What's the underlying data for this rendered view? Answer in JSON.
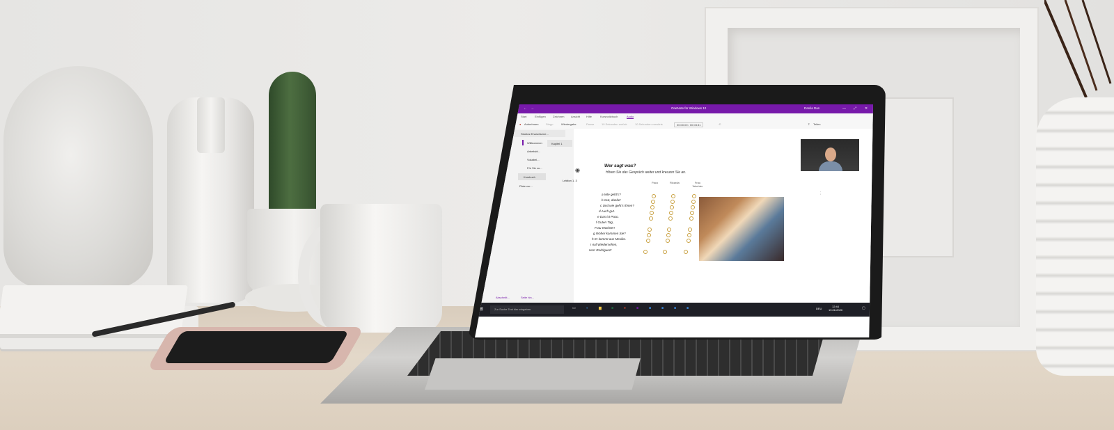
{
  "app": {
    "title": "OneNote für Windows 10",
    "user": "Danila Dan",
    "window_controls": [
      "—",
      "⤢",
      "✕"
    ]
  },
  "menu": [
    "Start",
    "Einfügen",
    "Zeichnen",
    "Ansicht",
    "Hilfe",
    "Kursnotizbuch",
    "Audio"
  ],
  "ribbon": {
    "record": "Aufnehmen",
    "stop": "Stopp",
    "play": "Wiedergabe",
    "pause": "Pause",
    "back10": "10 Sekunden zurück",
    "forward10": "10 Sekunden vorwärts",
    "position": "00:00:00 / 00:03:31",
    "share": "Teilen"
  },
  "nav": {
    "notebook": "Studios Erwachsene...",
    "sections": [
      "Willkommen",
      "Arbeitsbl...",
      "Vokabel...",
      "Für Sie zu...",
      "Kursbuch",
      "Platz zur..."
    ],
    "page": "Kapitel 1",
    "add_section": "Abschnitt...",
    "add_page": "Seite hin..."
  },
  "page": {
    "label": "Lektion 1, 3",
    "heading": "Wer sagt was?",
    "subheading": "Hören Sie das Gespräch weiter und kreuzen Sie an.",
    "columns": [
      "Paco",
      "Ricarda",
      "Frau Wachter"
    ],
    "lines": [
      "a  Wie geht's?",
      "b  Gut, danke!",
      "c  Und wie geht's Ihnen?",
      "d  Auch gut.",
      "e  Das ist Paco.",
      "f  Guten Tag,",
      "    Frau Wachter!",
      "g  Woher kommen Sie?",
      "h  Er kommt aus Mexiko.",
      "i  Auf Wiedersehen,",
      "    Herr Rodriguez!"
    ]
  },
  "taskbar": {
    "search_placeholder": "Zur Suche Text hier eingeben",
    "time": "12:44",
    "date": "19.06.2020",
    "lang": "DEU"
  }
}
